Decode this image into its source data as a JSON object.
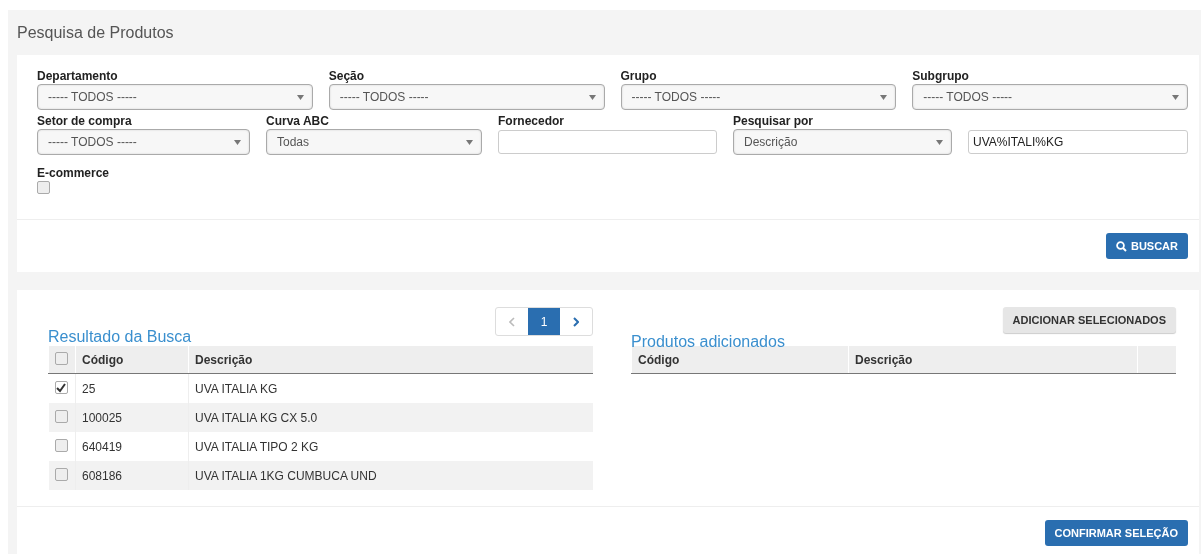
{
  "page": {
    "title": "Pesquisa de Produtos"
  },
  "filter_rows": [
    [
      {
        "kind": "select",
        "label": "Departamento",
        "value": "----- TODOS -----"
      },
      {
        "kind": "select",
        "label": "Seção",
        "value": "----- TODOS -----"
      },
      {
        "kind": "select",
        "label": "Grupo",
        "value": "----- TODOS -----"
      },
      {
        "kind": "select",
        "label": "Subgrupo",
        "value": "----- TODOS -----"
      }
    ],
    [
      {
        "kind": "select",
        "label": "Setor de compra",
        "value": "----- TODOS -----"
      },
      {
        "kind": "select",
        "label": "Curva ABC",
        "value": "Todas"
      },
      {
        "kind": "input",
        "label": "Fornecedor"
      },
      {
        "kind": "select",
        "label": "Pesquisar por",
        "value": "Descrição"
      },
      {
        "kind": "input",
        "value": "UVA%ITALI%KG"
      }
    ]
  ],
  "ecommerce": {
    "label": "E-commerce",
    "checked": false
  },
  "search_button": "BUSCAR",
  "results": {
    "title": "Resultado da Busca",
    "prev_disabled": true,
    "next_disabled": false,
    "pages": [
      {
        "label": "1",
        "selected": true
      }
    ],
    "all_checked": false,
    "columns": [
      "Código",
      "Descrição"
    ],
    "rows": [
      {
        "checked": true,
        "cells": [
          "25",
          "UVA ITALIA KG"
        ]
      },
      {
        "checked": false,
        "cells": [
          "100025",
          "UVA ITALIA KG CX 5.0"
        ]
      },
      {
        "checked": false,
        "cells": [
          "640419",
          "UVA ITALIA TIPO 2 KG"
        ]
      },
      {
        "checked": false,
        "cells": [
          "608186",
          "UVA ITALIA 1KG CUMBUCA UND"
        ]
      }
    ]
  },
  "added": {
    "title": "Produtos adicionados",
    "add_button": "ADICIONAR SELECIONADOS",
    "columns": [
      "Código",
      "Descrição"
    ]
  },
  "confirm_button": "CONFIRMAR SELEÇÃO"
}
